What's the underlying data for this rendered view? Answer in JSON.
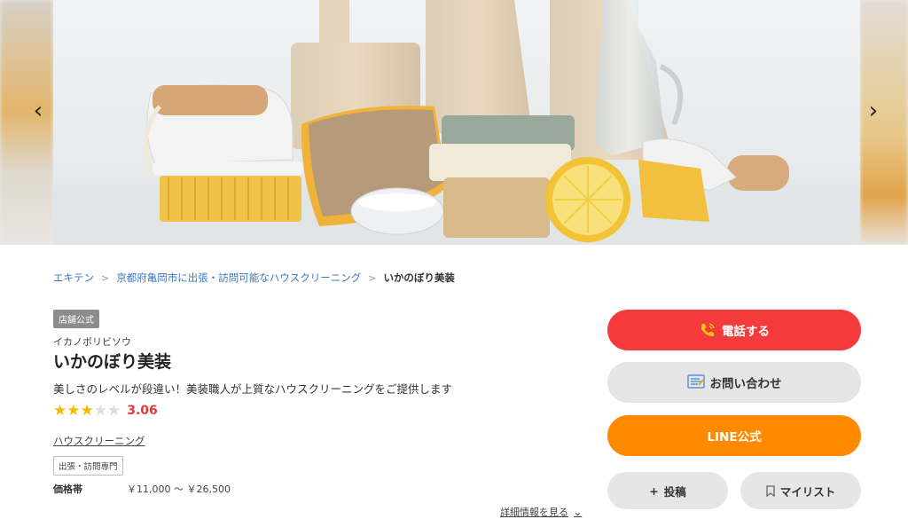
{
  "carousel": {
    "prev_icon": "chevron-left-icon",
    "next_icon": "chevron-right-icon"
  },
  "breadcrumb": {
    "items": [
      "エキテン",
      "京都府亀岡市に出張・訪問可能なハウスクリーニング"
    ],
    "current": "いかのぼり美装"
  },
  "shop": {
    "badge": "店舗公式",
    "kana": "イカノボリビソウ",
    "name": "いかのぼり美装",
    "tagline": "美しさのレベルが段違い！美装職人が上質なハウスクリーニングをご提供します",
    "rating": 3.06,
    "rating_text": "3.06",
    "stars_filled": 3,
    "stars_total": 5,
    "category": "ハウスクリーニング",
    "tag": "出張・訪問専門",
    "price_label": "価格帯",
    "price_value": "￥11,000 〜 ￥26,500",
    "details_link": "詳細情報を見る"
  },
  "actions": {
    "phone": "電話する",
    "contact": "お問い合わせ",
    "line": "LINE公式",
    "post": "投稿",
    "mylist": "マイリスト"
  },
  "colors": {
    "phone_button": "#f43a3a",
    "line_button": "#ff8a00",
    "neutral_button": "#e6e6e6",
    "link": "#3b78c4",
    "rating_value": "#e53935",
    "star_on": "#f6b800",
    "star_off": "#dcdcdc"
  }
}
